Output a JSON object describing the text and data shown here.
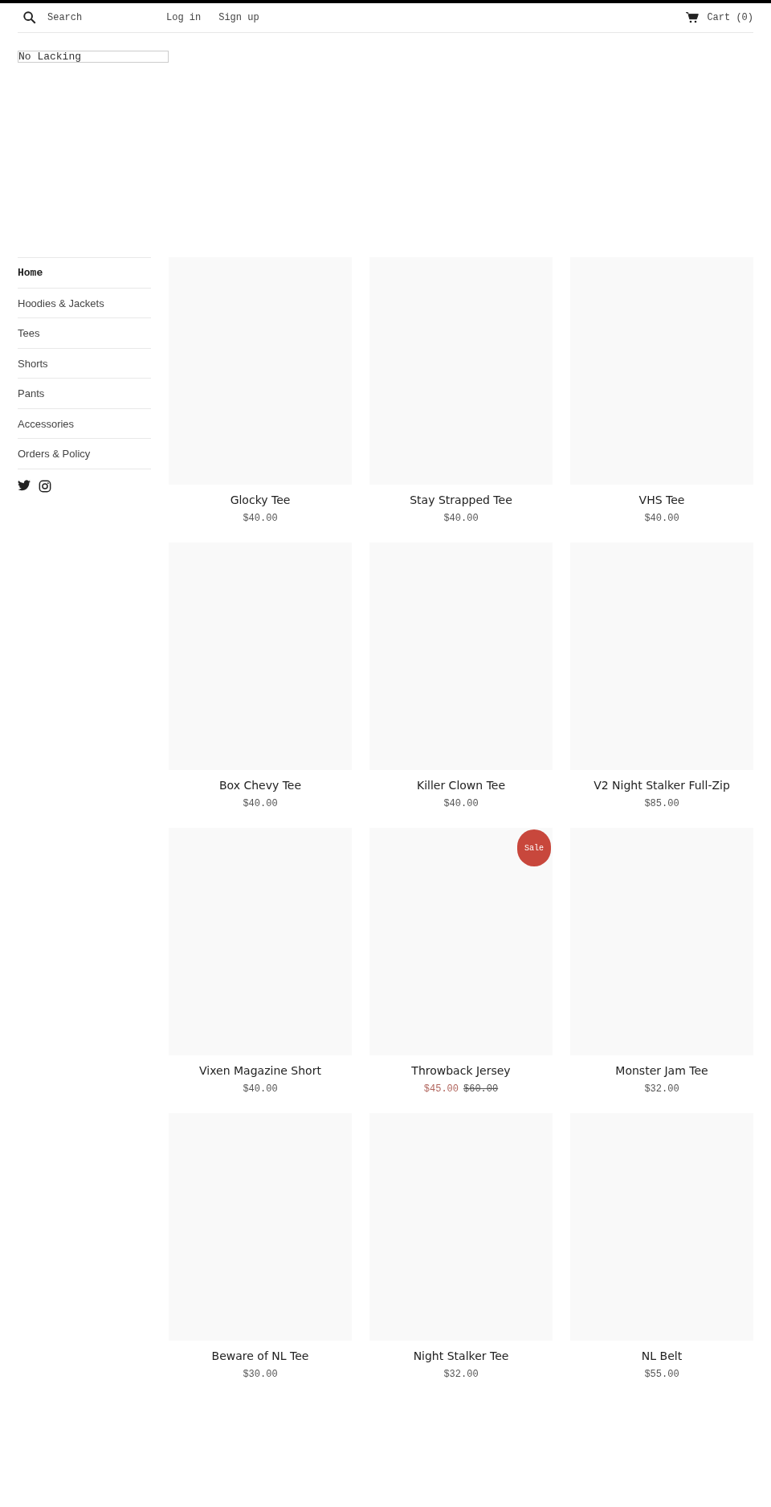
{
  "header": {
    "search": {
      "placeholder": "Search"
    },
    "links": [
      "Log in",
      "Sign up"
    ],
    "cart": "Cart (0)"
  },
  "logo_alt": "No Lacking",
  "sidebar": {
    "items": [
      {
        "label": "Home",
        "selected": true
      },
      {
        "label": "Hoodies & Jackets",
        "selected": false
      },
      {
        "label": "Tees",
        "selected": false
      },
      {
        "label": "Shorts",
        "selected": false
      },
      {
        "label": "Pants",
        "selected": false
      },
      {
        "label": "Accessories",
        "selected": false
      },
      {
        "label": "Orders & Policy",
        "selected": false
      }
    ],
    "social": [
      {
        "kind": "twitter"
      },
      {
        "kind": "instagram"
      }
    ]
  },
  "products": [
    {
      "title": "Glocky Tee",
      "price": "$40.00"
    },
    {
      "title": "Stay Strapped Tee",
      "price": "$40.00"
    },
    {
      "title": "VHS Tee",
      "price": "$40.00"
    },
    {
      "title": "Box Chevy Tee",
      "price": "$40.00"
    },
    {
      "title": "Killer Clown Tee",
      "price": "$40.00"
    },
    {
      "title": "V2 Night Stalker Full-Zip",
      "price": "$85.00"
    },
    {
      "title": "Vixen Magazine Short",
      "price": "$40.00"
    },
    {
      "title": "Throwback Jersey",
      "price": "$45.00",
      "compare_price": "$60.00",
      "badge": "Sale"
    },
    {
      "title": "Monster Jam Tee",
      "price": "$32.00"
    },
    {
      "title": "Beware of NL Tee",
      "price": "$30.00"
    },
    {
      "title": "Night Stalker Tee",
      "price": "$32.00"
    },
    {
      "title": "NL Belt",
      "price": "$55.00"
    }
  ]
}
